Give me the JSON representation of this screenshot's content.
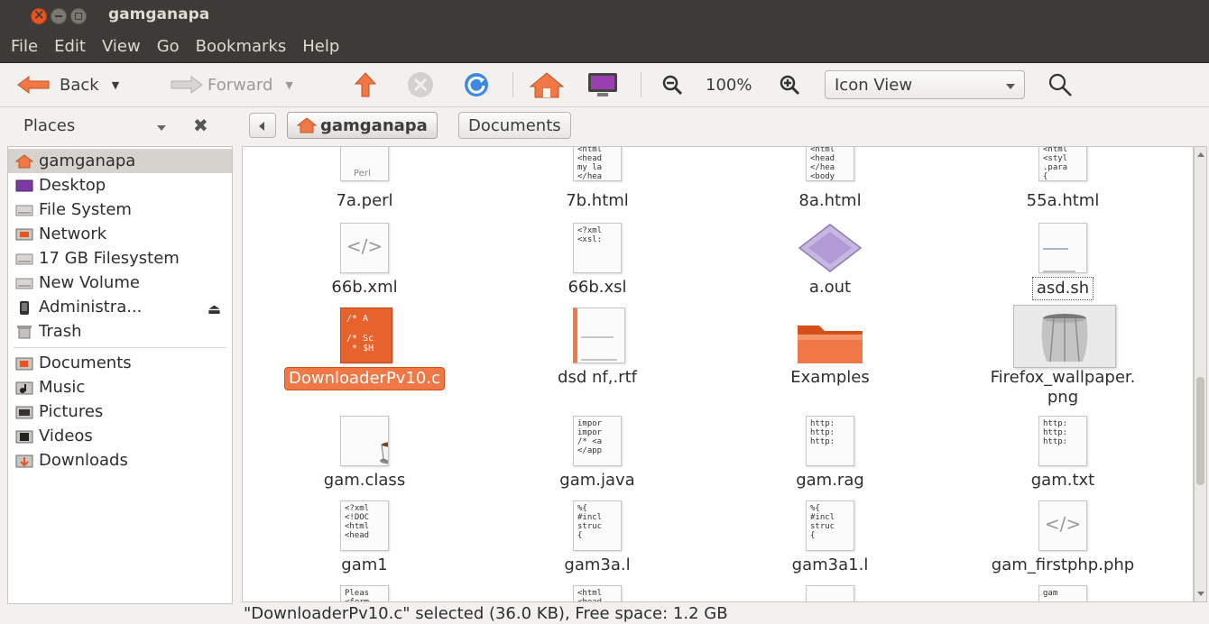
{
  "window": {
    "title": "gamganapa"
  },
  "menu": [
    "File",
    "Edit",
    "View",
    "Go",
    "Bookmarks",
    "Help"
  ],
  "toolbar": {
    "back": "Back",
    "forward": "Forward",
    "zoom": "100%",
    "view_mode": "Icon View"
  },
  "places": {
    "header": "Places",
    "items": [
      {
        "label": "gamganapa",
        "icon": "home-folder-icon",
        "selected": true
      },
      {
        "label": "Desktop",
        "icon": "desktop-icon"
      },
      {
        "label": "File System",
        "icon": "drive-icon"
      },
      {
        "label": "Network",
        "icon": "network-icon"
      },
      {
        "label": "17 GB Filesystem",
        "icon": "drive-icon"
      },
      {
        "label": "New Volume",
        "icon": "drive-icon"
      },
      {
        "label": "Administra...",
        "icon": "phone-icon"
      },
      {
        "label": "Trash",
        "icon": "trash-icon"
      }
    ],
    "bookmarks": [
      {
        "label": "Documents",
        "icon": "documents-folder-icon"
      },
      {
        "label": "Music",
        "icon": "music-folder-icon"
      },
      {
        "label": "Pictures",
        "icon": "pictures-folder-icon"
      },
      {
        "label": "Videos",
        "icon": "videos-folder-icon"
      },
      {
        "label": "Downloads",
        "icon": "downloads-folder-icon"
      }
    ]
  },
  "path": {
    "crumbs": [
      "gamganapa",
      "Documents"
    ]
  },
  "files": [
    {
      "name": "7a.perl",
      "thumb": "Perl"
    },
    {
      "name": "7b.html",
      "thumb": "<html\n<head\nmy la\n</hea"
    },
    {
      "name": "8a.html",
      "thumb": "<html\n<head\n</hea\n<body"
    },
    {
      "name": "55a.html",
      "thumb": "<html\n<styl\n.para\n{"
    },
    {
      "name": "66b.xml",
      "thumb": "</>"
    },
    {
      "name": "66b.xsl",
      "thumb": "<?xml\n<xsl:"
    },
    {
      "name": "a.out",
      "thumb": ""
    },
    {
      "name": "asd.sh",
      "thumb": ""
    },
    {
      "name": "DownloaderPv10.c",
      "thumb": "/* A\n\n/* Sc\n * $H"
    },
    {
      "name": "dsd nf,.rtf",
      "thumb": ""
    },
    {
      "name": "Examples",
      "thumb": ""
    },
    {
      "name": "Firefox_wallpaper.\npng",
      "thumb": ""
    },
    {
      "name": "gam.class",
      "thumb": ""
    },
    {
      "name": "gam.java",
      "thumb": "impor\nimpor\n/* <a\n</app"
    },
    {
      "name": "gam.rag",
      "thumb": "http:\nhttp:\nhttp:"
    },
    {
      "name": "gam.txt",
      "thumb": "http:\nhttp:\nhttp:"
    },
    {
      "name": "gam1",
      "thumb": "<?xml\n<!DOC\n<html\n<head"
    },
    {
      "name": "gam3a.l",
      "thumb": "%{\n#incl\nstruc\n{"
    },
    {
      "name": "gam3a1.l",
      "thumb": "%{\n#incl\nstruc\n{"
    },
    {
      "name": "gam_firstphp.php",
      "thumb": "</>"
    },
    {
      "name": "",
      "thumb": "Pleas\n<form"
    },
    {
      "name": "",
      "thumb": "<html\n<head"
    },
    {
      "name": "",
      "thumb": ""
    },
    {
      "name": "",
      "thumb": "gam"
    }
  ],
  "status": "\"DownloaderPv10.c\" selected (36.0 KB), Free space: 1.2 GB",
  "colors": {
    "accent": "#f07746",
    "titlebar": "#3c3b37",
    "folder": "#e8622c"
  }
}
